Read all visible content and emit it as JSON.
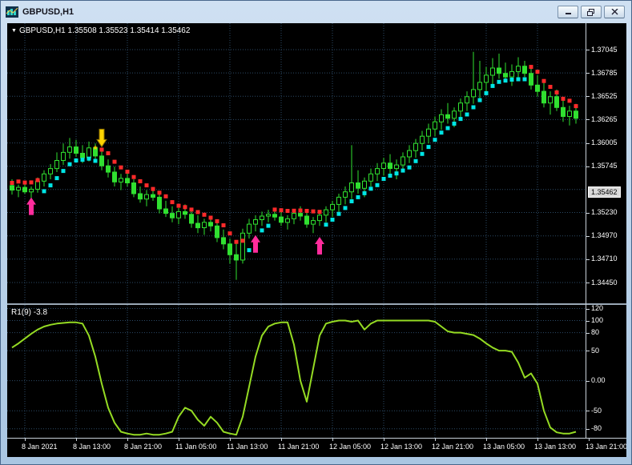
{
  "window": {
    "title": "GBPUSD,H1"
  },
  "chart": {
    "symbol_marker": "▼",
    "ohlc_text": "GBPUSD,H1  1.35508 1.35523 1.35414 1.35462",
    "indicator_label": "R1(9) -3.8"
  },
  "colors": {
    "grid": "#2C4A66",
    "candle": "#30E030",
    "candle_bull_fill": "#000000",
    "dot_up": "#00E5E5",
    "dot_down": "#FF2A2A",
    "indicator": "#95DB23",
    "price_box_bg": "#D9D9D9"
  },
  "chart_data": {
    "type": "candlestick",
    "symbol": "GBPUSD",
    "timeframe": "H1",
    "main": {
      "price_range": [
        1.34218,
        1.37339
      ],
      "price_axis": [
        {
          "label": "1.37045",
          "value": 1.37045
        },
        {
          "label": "1.36785",
          "value": 1.36785
        },
        {
          "label": "1.36525",
          "value": 1.36525
        },
        {
          "label": "1.36265",
          "value": 1.36265
        },
        {
          "label": "1.36005",
          "value": 1.36005
        },
        {
          "label": "1.35745",
          "value": 1.35745
        },
        {
          "label": "1.35230",
          "value": 1.3523
        },
        {
          "label": "1.34970",
          "value": 1.3497
        },
        {
          "label": "1.34710",
          "value": 1.3471
        },
        {
          "label": "1.34450",
          "value": 1.3445
        }
      ],
      "grid_extra": [
        1.35487
      ],
      "current_price": {
        "label": "1.35462",
        "value": 1.35462
      },
      "candles": [
        [
          1.3553,
          1.356,
          1.3543,
          1.3548
        ],
        [
          1.3548,
          1.3554,
          1.354,
          1.3551
        ],
        [
          1.3551,
          1.3558,
          1.3544,
          1.3546
        ],
        [
          1.3546,
          1.3552,
          1.3536,
          1.3549
        ],
        [
          1.3549,
          1.3562,
          1.3545,
          1.3558
        ],
        [
          1.3558,
          1.357,
          1.3552,
          1.3566
        ],
        [
          1.3566,
          1.3577,
          1.356,
          1.3572
        ],
        [
          1.3572,
          1.359,
          1.3568,
          1.3581
        ],
        [
          1.3581,
          1.36,
          1.3576,
          1.359
        ],
        [
          1.359,
          1.3606,
          1.3583,
          1.3596
        ],
        [
          1.3596,
          1.3604,
          1.3585,
          1.3589
        ],
        [
          1.3589,
          1.3598,
          1.3578,
          1.3584
        ],
        [
          1.3584,
          1.3602,
          1.358,
          1.3595
        ],
        [
          1.3595,
          1.36,
          1.3582,
          1.3586
        ],
        [
          1.3586,
          1.3592,
          1.357,
          1.3575
        ],
        [
          1.3575,
          1.3582,
          1.3562,
          1.3568
        ],
        [
          1.3568,
          1.3574,
          1.3552,
          1.3557
        ],
        [
          1.3557,
          1.3566,
          1.3548,
          1.3561
        ],
        [
          1.3561,
          1.3568,
          1.3552,
          1.3556
        ],
        [
          1.3556,
          1.356,
          1.354,
          1.3544
        ],
        [
          1.3544,
          1.3552,
          1.3534,
          1.3538
        ],
        [
          1.3538,
          1.3548,
          1.353,
          1.3543
        ],
        [
          1.3543,
          1.355,
          1.3536,
          1.354
        ],
        [
          1.354,
          1.3544,
          1.3522,
          1.3527
        ],
        [
          1.3527,
          1.3536,
          1.3518,
          1.3522
        ],
        [
          1.3522,
          1.353,
          1.3512,
          1.3517
        ],
        [
          1.3517,
          1.3528,
          1.351,
          1.3524
        ],
        [
          1.3524,
          1.3532,
          1.3516,
          1.3521
        ],
        [
          1.3521,
          1.3526,
          1.3506,
          1.3511
        ],
        [
          1.3511,
          1.352,
          1.35,
          1.3506
        ],
        [
          1.3506,
          1.3516,
          1.3498,
          1.3512
        ],
        [
          1.3512,
          1.3518,
          1.3502,
          1.3508
        ],
        [
          1.3508,
          1.3512,
          1.349,
          1.3495
        ],
        [
          1.3495,
          1.3504,
          1.3482,
          1.3488
        ],
        [
          1.3488,
          1.3494,
          1.3466,
          1.3476
        ],
        [
          1.3476,
          1.349,
          1.3448,
          1.347
        ],
        [
          1.347,
          1.3505,
          1.3466,
          1.35
        ],
        [
          1.35,
          1.3516,
          1.3494,
          1.351
        ],
        [
          1.351,
          1.352,
          1.3502,
          1.3515
        ],
        [
          1.3515,
          1.3524,
          1.3508,
          1.3519
        ],
        [
          1.3519,
          1.3526,
          1.3512,
          1.3521
        ],
        [
          1.3521,
          1.3528,
          1.3514,
          1.3518
        ],
        [
          1.3518,
          1.3524,
          1.3508,
          1.3512
        ],
        [
          1.3512,
          1.352,
          1.3504,
          1.3516
        ],
        [
          1.3516,
          1.3526,
          1.351,
          1.3522
        ],
        [
          1.3522,
          1.353,
          1.3514,
          1.3519
        ],
        [
          1.3519,
          1.3524,
          1.3506,
          1.351
        ],
        [
          1.351,
          1.3518,
          1.35,
          1.3514
        ],
        [
          1.3514,
          1.3524,
          1.3508,
          1.352
        ],
        [
          1.352,
          1.353,
          1.3512,
          1.3526
        ],
        [
          1.3526,
          1.3536,
          1.3518,
          1.3532
        ],
        [
          1.3532,
          1.3544,
          1.3524,
          1.354
        ],
        [
          1.354,
          1.3552,
          1.3532,
          1.3546
        ],
        [
          1.3546,
          1.3598,
          1.3538,
          1.3556
        ],
        [
          1.3556,
          1.357,
          1.3544,
          1.355
        ],
        [
          1.355,
          1.3562,
          1.354,
          1.3558
        ],
        [
          1.3558,
          1.3572,
          1.3552,
          1.3566
        ],
        [
          1.3566,
          1.3578,
          1.3558,
          1.3572
        ],
        [
          1.3572,
          1.3584,
          1.3564,
          1.3578
        ],
        [
          1.3578,
          1.3588,
          1.3566,
          1.3572
        ],
        [
          1.3572,
          1.3582,
          1.356,
          1.3576
        ],
        [
          1.3576,
          1.359,
          1.357,
          1.3585
        ],
        [
          1.3585,
          1.3598,
          1.3578,
          1.3592
        ],
        [
          1.3592,
          1.3605,
          1.3584,
          1.36
        ],
        [
          1.36,
          1.3614,
          1.3592,
          1.3608
        ],
        [
          1.3608,
          1.3622,
          1.36,
          1.3616
        ],
        [
          1.3616,
          1.363,
          1.3608,
          1.3624
        ],
        [
          1.3624,
          1.3638,
          1.3615,
          1.3632
        ],
        [
          1.3632,
          1.3645,
          1.3622,
          1.3628
        ],
        [
          1.3628,
          1.364,
          1.3618,
          1.3636
        ],
        [
          1.3636,
          1.365,
          1.3628,
          1.3645
        ],
        [
          1.3645,
          1.3658,
          1.3636,
          1.3652
        ],
        [
          1.3652,
          1.3702,
          1.3644,
          1.366
        ],
        [
          1.366,
          1.3692,
          1.365,
          1.3668
        ],
        [
          1.3668,
          1.3685,
          1.3658,
          1.3676
        ],
        [
          1.3676,
          1.3695,
          1.3666,
          1.3684
        ],
        [
          1.3684,
          1.37,
          1.3672,
          1.3678
        ],
        [
          1.3678,
          1.369,
          1.3668,
          1.3674
        ],
        [
          1.3674,
          1.3688,
          1.3664,
          1.368
        ],
        [
          1.368,
          1.3696,
          1.367,
          1.3686
        ],
        [
          1.3686,
          1.3692,
          1.3674,
          1.3678
        ],
        [
          1.3678,
          1.3684,
          1.366,
          1.3665
        ],
        [
          1.3665,
          1.3676,
          1.3652,
          1.3658
        ],
        [
          1.3658,
          1.3668,
          1.364,
          1.3645
        ],
        [
          1.3645,
          1.3658,
          1.3632,
          1.3652
        ],
        [
          1.3652,
          1.366,
          1.3636,
          1.364
        ],
        [
          1.364,
          1.365,
          1.3624,
          1.363
        ],
        [
          1.363,
          1.3642,
          1.362,
          1.3636
        ],
        [
          1.3636,
          1.3644,
          1.3622,
          1.3628
        ]
      ],
      "trend": "rrrrrcccccccccrrrrrrrrrrrrrrrrrrrrrrrccccrrrrrrrrccccccccccccccccccccccccccccccccrrrrrrrr",
      "arrows": [
        {
          "i": 3,
          "price": 1.353,
          "dir": "up",
          "color": "#FF2C9C"
        },
        {
          "i": 14,
          "price": 1.3606,
          "dir": "down",
          "color": "#FFD400",
          "outline": "#8a6d00"
        },
        {
          "i": 38,
          "price": 1.3488,
          "dir": "up",
          "color": "#FF2C9C"
        },
        {
          "i": 48,
          "price": 1.3486,
          "dir": "up",
          "color": "#FF2C9C"
        }
      ],
      "star": {
        "i": 13,
        "price": 1.3593,
        "color": "#FFD400",
        "glyph": "*"
      }
    },
    "indicator": {
      "name": "R1(9)",
      "value": "-3.8",
      "range": [
        -95,
        126
      ],
      "axis": [
        {
          "label": "120",
          "value": 120
        },
        {
          "label": "100",
          "value": 100
        },
        {
          "label": "80",
          "value": 80
        },
        {
          "label": "50",
          "value": 50
        },
        {
          "label": "0.00",
          "value": 0
        },
        {
          "label": "-50",
          "value": -50
        },
        {
          "label": "-80",
          "value": -80
        }
      ],
      "values": [
        55,
        62,
        70,
        78,
        85,
        90,
        93,
        95,
        96,
        97,
        97,
        95,
        75,
        40,
        -5,
        -45,
        -70,
        -85,
        -88,
        -90,
        -90,
        -88,
        -90,
        -90,
        -88,
        -85,
        -60,
        -45,
        -50,
        -65,
        -75,
        -60,
        -70,
        -85,
        -88,
        -90,
        -60,
        -10,
        40,
        75,
        90,
        95,
        97,
        97,
        60,
        0,
        -35,
        20,
        75,
        95,
        98,
        100,
        100,
        98,
        100,
        85,
        95,
        100,
        100,
        100,
        100,
        100,
        100,
        100,
        100,
        100,
        98,
        90,
        82,
        80,
        80,
        78,
        76,
        70,
        62,
        55,
        50,
        50,
        48,
        30,
        5,
        12,
        -5,
        -50,
        -78,
        -86,
        -88,
        -88,
        -85
      ]
    },
    "time_ticks": [
      {
        "i": 2,
        "label": "8 Jan 2021"
      },
      {
        "i": 10,
        "label": "8 Jan 13:00"
      },
      {
        "i": 18,
        "label": "8 Jan 21:00"
      },
      {
        "i": 26,
        "label": "11 Jan 05:00"
      },
      {
        "i": 34,
        "label": "11 Jan 13:00"
      },
      {
        "i": 42,
        "label": "11 Jan 21:00"
      },
      {
        "i": 50,
        "label": "12 Jan 05:00"
      },
      {
        "i": 58,
        "label": "12 Jan 13:00"
      },
      {
        "i": 66,
        "label": "12 Jan 21:00"
      },
      {
        "i": 74,
        "label": "13 Jan 05:00"
      },
      {
        "i": 82,
        "label": "13 Jan 13:00"
      },
      {
        "i": 90,
        "label": "13 Jan 21:00"
      }
    ]
  }
}
